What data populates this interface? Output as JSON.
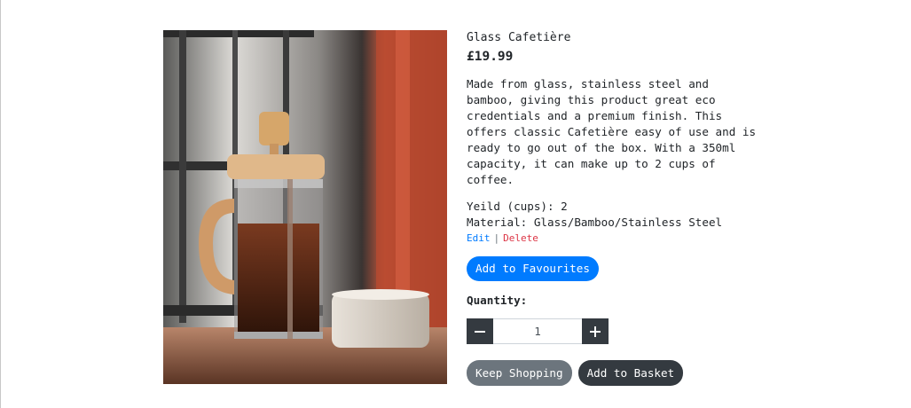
{
  "product": {
    "name": "Glass Cafetière",
    "price": "£19.99",
    "description": "Made from glass, stainless steel and bamboo, giving this product great eco credentials and a premium finish. This offers classic Cafetière easy of use and is ready to go out of the box. With a 350ml capacity, it can make up to 2 cups of coffee.",
    "yield": "Yeild (cups): 2",
    "material": "Material: Glass/Bamboo/Stainless Steel"
  },
  "admin": {
    "edit_label": "Edit",
    "separator": "|",
    "delete_label": "Delete"
  },
  "favourites_label": "Add to Favourites",
  "quantity": {
    "label": "Quantity:",
    "value": "1",
    "decrement_icon": "minus-icon",
    "increment_icon": "plus-icon"
  },
  "actions": {
    "keep_shopping_label": "Keep Shopping",
    "add_to_basket_label": "Add to Basket"
  },
  "colors": {
    "primary": "#007bff",
    "danger": "#dc3545",
    "secondary": "#6c757d",
    "dark": "#343a40"
  }
}
